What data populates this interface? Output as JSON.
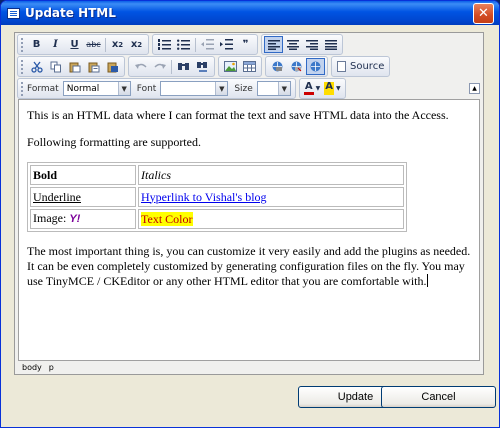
{
  "window": {
    "title": "Update HTML",
    "close_glyph": "✕"
  },
  "toolbar": {
    "row1": {
      "bold": "B",
      "italic": "I",
      "underline": "U",
      "strike": "abc",
      "subscript_base": "x",
      "subscript_mark": "2",
      "superscript_base": "x",
      "superscript_mark": "2",
      "blockquote": "❞"
    },
    "row2": {
      "source_label": "Source"
    },
    "row3": {
      "format_label": "Format",
      "format_value": "Normal",
      "font_label": "Font",
      "font_value": "",
      "size_label": "Size",
      "size_value": "",
      "text_color_glyph": "A",
      "bg_color_glyph": "A"
    }
  },
  "content": {
    "para1": "This is an HTML data where I can format the text and save HTML data into the Access.",
    "para2": "Following formatting are supported.",
    "table": {
      "r1c1": "Bold",
      "r1c2": "Italics",
      "r2c1": "Underline",
      "r2c2": "Hyperlink to Vishal's blog",
      "r3c1": "Image:",
      "r3c1_icon": "Y!",
      "r3c2": "Text Color"
    },
    "para3": "The most important thing is, you can customize it very easily and add the plugins as needed. It can be even completely customized by generating configuration files on the fly. You may use TinyMCE / CKEditor or any other HTML editor that you are comfortable with."
  },
  "statusbar": {
    "path1": "body",
    "path2": "p"
  },
  "buttons": {
    "update": "Update",
    "cancel": "Cancel"
  },
  "colors": {
    "titlebar": "#0054e3",
    "dialog_bg": "#ece9d8",
    "text_color_highlight": "#ffff00",
    "text_color_fg": "#c00000"
  }
}
